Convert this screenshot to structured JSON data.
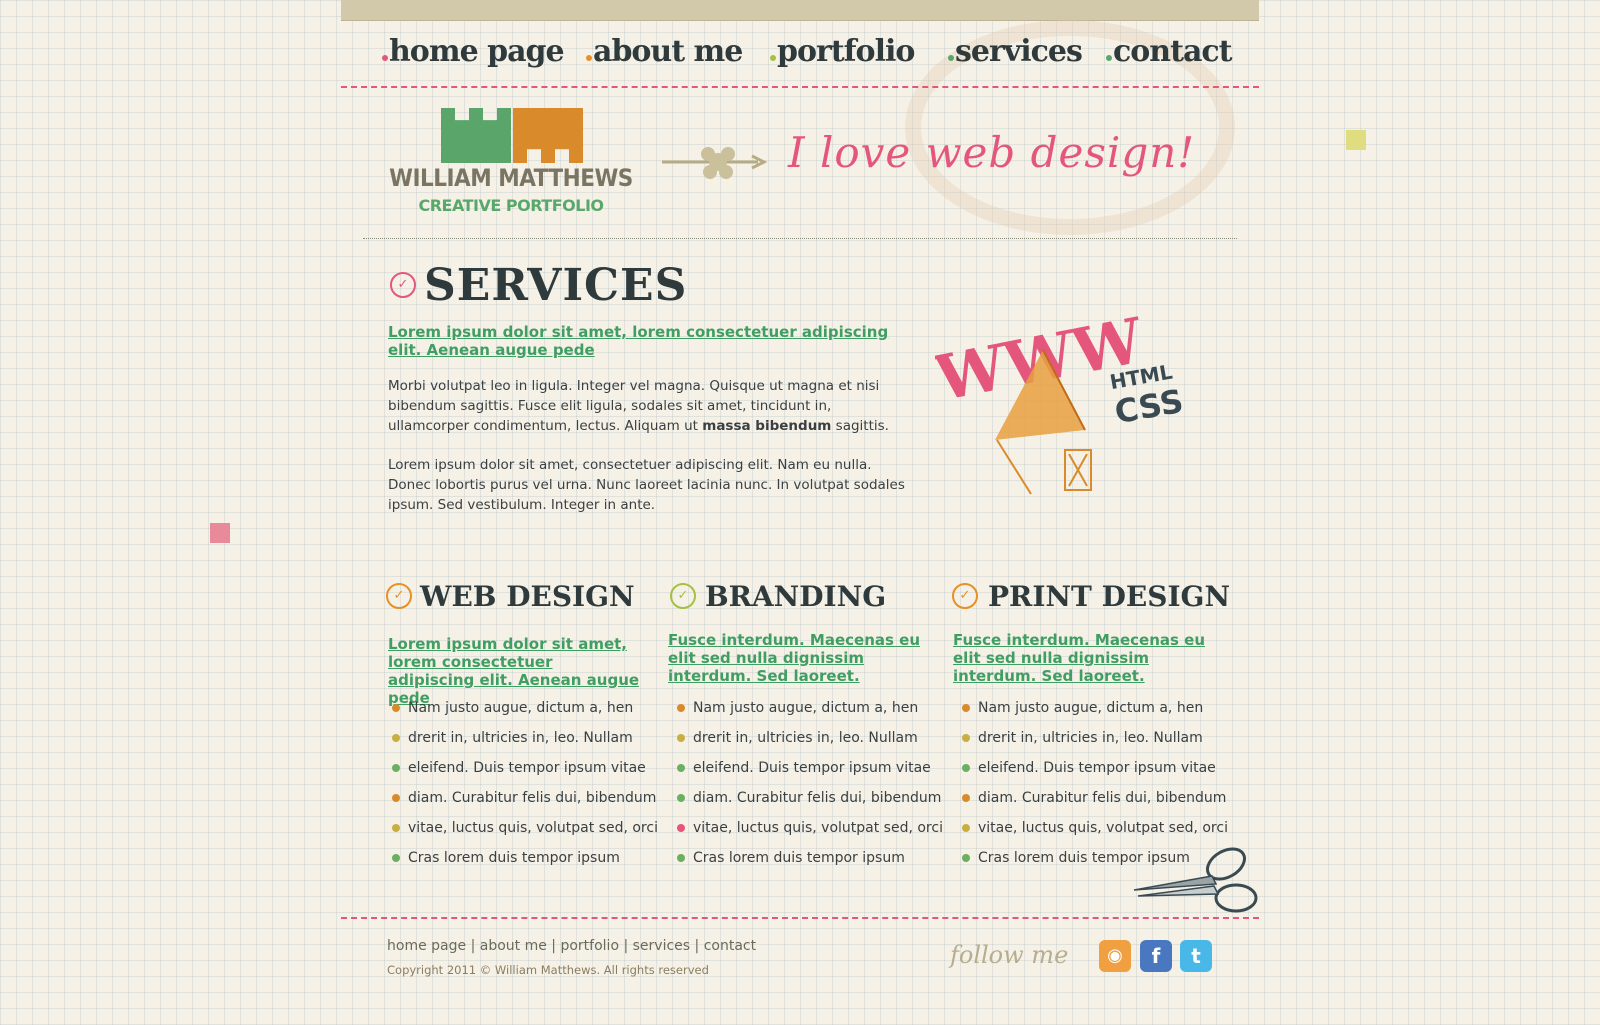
{
  "nav": {
    "items": [
      {
        "label": "home page",
        "dot": "#e4567c"
      },
      {
        "label": "about me",
        "dot": "#e69028"
      },
      {
        "label": "portfolio",
        "dot": "#a6c040"
      },
      {
        "label": "services",
        "dot": "#58a86a"
      },
      {
        "label": "contact",
        "dot": "#58a86a"
      }
    ]
  },
  "header": {
    "logo_name": "WILLIAM MATTHEWS",
    "logo_sub": "CREATIVE PORTFOLIO",
    "tagline": "I love web design!"
  },
  "main": {
    "title": "SERVICES",
    "lead": "Lorem ipsum dolor sit amet, lorem consectetuer adipiscing elit. Aenean augue pede",
    "p1_part1": "Morbi volutpat leo in ligula. Integer vel magna. Quisque ut magna et nisi bibendum sagittis. Fusce elit ligula, sodales sit amet, tincidunt in, ullamcorper condimentum, lectus. Aliquam ut ",
    "p1_bold": "massa bibendum",
    "p1_part2": " sagittis.",
    "p2": "Lorem ipsum dolor sit amet, consectetuer adipiscing elit. Nam eu nulla. Donec lobortis purus vel urna. Nunc laoreet lacinia nunc. In volutpat sodales ipsum. Sed vestibulum. Integer in ante.",
    "illustration": {
      "text1": "WWW",
      "text2": "HTML",
      "text3": "CSS"
    }
  },
  "columns": [
    {
      "title": "WEB DESIGN",
      "lead": "Lorem ipsum dolor sit amet, lorem consectetuer adipiscing elit. Aenean augue pede",
      "items": [
        "Nam justo augue, dictum a, hen",
        "drerit in, ultricies in, leo. Nullam",
        "eleifend. Duis tempor ipsum vitae",
        "diam. Curabitur felis dui, bibendum",
        "vitae, luctus quis, volutpat sed, orci",
        "Cras lorem duis tempor ipsum"
      ]
    },
    {
      "title": "BRANDING",
      "lead": "Fusce interdum. Maecenas eu elit sed nulla dignissim interdum. Sed laoreet.",
      "items": [
        "Nam justo augue, dictum a, hen",
        "drerit in, ultricies in, leo. Nullam",
        "eleifend. Duis tempor ipsum vitae",
        "diam. Curabitur felis dui, bibendum",
        "vitae, luctus quis, volutpat sed, orci",
        "Cras lorem duis tempor ipsum"
      ]
    },
    {
      "title": "PRINT DESIGN",
      "lead": "Fusce interdum. Maecenas eu elit sed nulla dignissim interdum. Sed laoreet.",
      "items": [
        "Nam justo augue, dictum a, hen",
        "drerit in, ultricies in, leo. Nullam",
        "eleifend. Duis tempor ipsum vitae",
        "diam. Curabitur felis dui, bibendum",
        "vitae, luctus quis, volutpat sed, orci",
        "Cras lorem duis tempor ipsum"
      ]
    }
  ],
  "footer": {
    "links": [
      "home page",
      "about me",
      "portfolio",
      "services",
      "contact"
    ],
    "separator": "|",
    "copyright": "Copyright 2011 © William Matthews. All rights reserved",
    "follow_label": "follow me"
  },
  "colors": {
    "accent_pink": "#e4567c",
    "accent_green": "#3f9e62",
    "accent_orange": "#d98a2a",
    "text_dark": "#2f3a3c"
  },
  "icons": [
    "rss-icon",
    "facebook-icon",
    "twitter-icon",
    "scissors-icon",
    "flower-arrow-icon",
    "section-badge-icon"
  ]
}
